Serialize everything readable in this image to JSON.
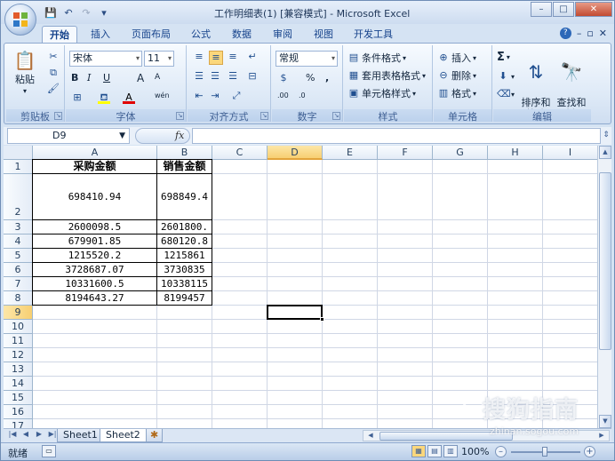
{
  "window": {
    "title": "工作明细表(1)  [兼容模式] - Microsoft Excel",
    "controls": [
      "–",
      "□",
      "✕"
    ]
  },
  "qat": {
    "save": "💾",
    "undo": "↶",
    "redo": "↷",
    "customize": "▾"
  },
  "ribbon": {
    "tabs": [
      "开始",
      "插入",
      "页面布局",
      "公式",
      "数据",
      "审阅",
      "视图",
      "开发工具"
    ],
    "active_tab": "开始",
    "right_icons": {
      "help": "?",
      "minimize": "–",
      "restore": "▫",
      "close": "✕"
    },
    "groups": {
      "clipboard": {
        "label": "剪贴板",
        "paste": "粘贴"
      },
      "font": {
        "label": "字体",
        "font_name": "宋体",
        "font_size": "11",
        "bold": "B",
        "italic": "I",
        "underline": "U",
        "grow": "A",
        "shrink": "A",
        "wen": "wén"
      },
      "alignment": {
        "label": "对齐方式"
      },
      "number": {
        "label": "数字",
        "format": "常规",
        "percent": "%",
        "comma": ",",
        "currency": "$",
        "inc": ".00",
        "dec": ".0"
      },
      "styles": {
        "label": "样式",
        "conditional": "条件格式",
        "table": "套用表格格式",
        "cell": "单元格样式"
      },
      "cells": {
        "label": "单元格",
        "insert": "插入",
        "delete": "删除",
        "format": "格式"
      },
      "editing": {
        "label": "编辑",
        "sigma": "Σ",
        "sort": "排序和\n筛选",
        "find": "查找和\n选择"
      }
    }
  },
  "formula_bar": {
    "name_box": "D9",
    "fx": "fx",
    "value": ""
  },
  "grid": {
    "columns": [
      "A",
      "B",
      "C",
      "D",
      "E",
      "F",
      "G",
      "H",
      "I"
    ],
    "rows": [
      "1",
      "2",
      "3",
      "4",
      "5",
      "6",
      "7",
      "8",
      "9",
      "10",
      "11",
      "12",
      "13",
      "14",
      "15",
      "16",
      "17"
    ],
    "selected_col": "D",
    "selected_row": "9",
    "data": [
      [
        "采购金额",
        "销售金额"
      ],
      [
        "698410.94",
        "698849.4"
      ],
      [
        "2600098.5",
        "2601800."
      ],
      [
        "679901.85",
        "680120.8"
      ],
      [
        "1215520.2",
        "1215861"
      ],
      [
        "3728687.07",
        "3730835"
      ],
      [
        "10331600.5",
        "10338115"
      ],
      [
        "8194643.27",
        "8199457"
      ]
    ]
  },
  "sheets": {
    "tabs": [
      "Sheet1",
      "Sheet2"
    ],
    "active": "Sheet2",
    "new_sheet_icon": "✱"
  },
  "status": {
    "text": "就绪",
    "zoom": "100%",
    "minus": "–",
    "plus": "+"
  },
  "watermark": {
    "main": "搜狗指南",
    "url": "zhinan.sogou.com"
  }
}
